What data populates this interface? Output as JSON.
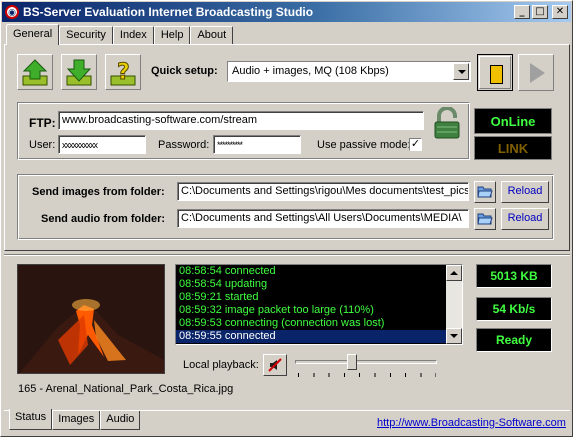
{
  "window": {
    "title": "BS-Server Evaluation Internet Broadcasting Studio",
    "minimize": "_",
    "maximize": "□",
    "close": "✕"
  },
  "tabs": [
    "General",
    "Security",
    "Index",
    "Help",
    "About"
  ],
  "active_tab": "General",
  "toolbar": {
    "icons": [
      "upload-arrow-icon",
      "download-arrow-icon",
      "help-question-icon"
    ]
  },
  "quick_setup": {
    "label": "Quick setup:",
    "value": "Audio + images, MQ (108 Kbps)"
  },
  "ftp": {
    "label": "FTP:",
    "value": "www.broadcasting-software.com/stream",
    "user_label": "User:",
    "user_value": "xxxxxxxxxx",
    "password_label": "Password:",
    "password_value": "**********",
    "passive_label": "Use passive mode:",
    "passive_checked": "✓"
  },
  "status": {
    "online": "OnLine",
    "link": "LINK",
    "online_color": "#40ff40",
    "link_color": "#806000"
  },
  "folders": {
    "images_label": "Send images from folder:",
    "images_path": "C:\\Documents and Settings\\rigou\\Mes documents\\test_pics",
    "audio_label": "Send audio from folder:",
    "audio_path": "C:\\Documents and Settings\\All Users\\Documents\\MEDIA\\",
    "reload": "Reload"
  },
  "log": [
    {
      "text": "08:58:54 connected",
      "selected": false
    },
    {
      "text": "08:58:54 updating",
      "selected": false
    },
    {
      "text": "08:59:21 started",
      "selected": false
    },
    {
      "text": "08:59:32 image packet too large (110%)",
      "selected": false
    },
    {
      "text": "08:59:53 connecting (connection was lost)",
      "selected": false
    },
    {
      "text": "08:59:55 connected",
      "selected": true
    }
  ],
  "stats": {
    "size": "5013 KB",
    "rate": "54 Kb/s",
    "state": "Ready"
  },
  "image_caption": "165 - Arenal_National_Park_Costa_Rica.jpg",
  "local_playback": {
    "label": "Local playback:",
    "volume_fraction": 0.38
  },
  "bottom_tabs": [
    "Status",
    "Images",
    "Audio"
  ],
  "footer_link": "http://www.Broadcasting-Software.com"
}
